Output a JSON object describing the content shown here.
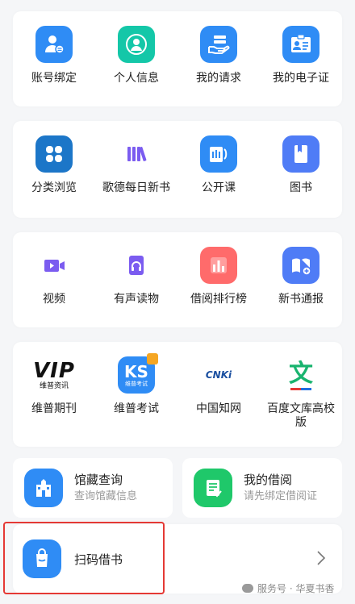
{
  "rows": [
    [
      {
        "label": "账号绑定",
        "icon": "user-bind-icon"
      },
      {
        "label": "个人信息",
        "icon": "person-icon"
      },
      {
        "label": "我的请求",
        "icon": "request-hand-icon"
      },
      {
        "label": "我的电子证",
        "icon": "id-card-icon"
      }
    ],
    [
      {
        "label": "分类浏览",
        "icon": "category-grid-icon"
      },
      {
        "label": "歌德每日新书",
        "icon": "books-shelf-icon"
      },
      {
        "label": "公开课",
        "icon": "open-course-icon"
      },
      {
        "label": "图书",
        "icon": "book-icon"
      }
    ],
    [
      {
        "label": "视频",
        "icon": "video-camera-icon"
      },
      {
        "label": "有声读物",
        "icon": "audiobook-headphone-icon"
      },
      {
        "label": "借阅排行榜",
        "icon": "ranking-bars-icon"
      },
      {
        "label": "新书通报",
        "icon": "new-book-notice-icon"
      }
    ],
    [
      {
        "label": "维普期刊",
        "icon": "vip-journal-logo",
        "logo_text": "VIP",
        "logo_sub": "维普资讯"
      },
      {
        "label": "维普考试",
        "icon": "vip-exam-logo",
        "logo_text": "KS",
        "logo_sub": "维普考试"
      },
      {
        "label": "中国知网",
        "icon": "cnki-logo",
        "logo_text": "CNKi"
      },
      {
        "label": "百度文库高校版",
        "icon": "baidu-wenku-logo",
        "logo_text": "文"
      }
    ]
  ],
  "collection": {
    "title": "馆藏查询",
    "subtitle": "查询馆藏信息",
    "icon": "library-building-icon"
  },
  "borrow": {
    "title": "我的借阅",
    "subtitle": "请先绑定借阅证",
    "icon": "borrow-document-icon"
  },
  "scan": {
    "label": "扫码借书",
    "icon": "scan-bag-icon"
  },
  "watermark": "服务号 · 华夏书香",
  "colors": {
    "blue": "#2f8cf5",
    "teal": "#14c7a8",
    "green": "#1fc86a",
    "purple": "#7b5cf0",
    "red": "#ff6b6b",
    "highlight": "#e53935"
  }
}
